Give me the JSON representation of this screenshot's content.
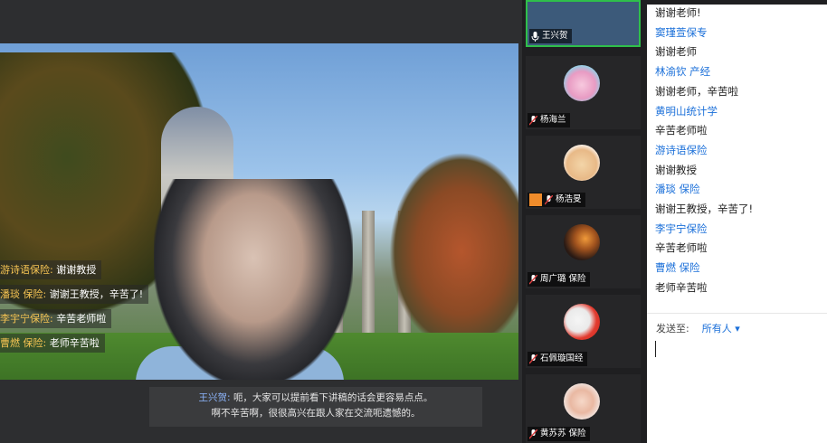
{
  "overlay_chat": [
    {
      "name": "游诗语保险:",
      "text": "谢谢教授"
    },
    {
      "name": "潘琰 保险:",
      "text": "谢谢王教授，辛苦了!"
    },
    {
      "name": "李宇宁保险:",
      "text": "辛苦老师啦"
    },
    {
      "name": "曹燃 保险:",
      "text": "老师辛苦啦"
    }
  ],
  "caption": {
    "speaker": "王兴贺:",
    "line1": "呃，大家可以提前看下讲稿的话会更容易点点。",
    "line2": "啊不辛苦啊，很很高兴在跟人家在交流呃遗憾的。"
  },
  "participants": [
    {
      "label": "王兴贺",
      "active": true
    },
    {
      "label": "杨海兰"
    },
    {
      "label": "杨浩旻"
    },
    {
      "label": "周广璐 保险"
    },
    {
      "label": "石佩璇国经"
    },
    {
      "label": "黄苏苏 保险"
    }
  ],
  "chat_panel": [
    {
      "type": "text",
      "value": "谢谢老师!"
    },
    {
      "type": "name",
      "value": "窦瑾萱保专"
    },
    {
      "type": "text",
      "value": "谢谢老师"
    },
    {
      "type": "name",
      "value": "林渝钦 产经"
    },
    {
      "type": "text",
      "value": "谢谢老师，辛苦啦"
    },
    {
      "type": "name",
      "value": "黄明山统计学"
    },
    {
      "type": "text",
      "value": "辛苦老师啦"
    },
    {
      "type": "name",
      "value": "游诗语保险"
    },
    {
      "type": "text",
      "value": "谢谢教授"
    },
    {
      "type": "name",
      "value": "潘琰 保险"
    },
    {
      "type": "text",
      "value": "谢谢王教授，辛苦了!"
    },
    {
      "type": "name",
      "value": "李宇宁保险"
    },
    {
      "type": "text",
      "value": "辛苦老师啦"
    },
    {
      "type": "name",
      "value": "曹燃 保险"
    },
    {
      "type": "text",
      "value": "老师辛苦啦"
    }
  ],
  "send": {
    "label": "发送至:",
    "target": "所有人 ▾"
  },
  "colors": {
    "accent": "#1a6fd9",
    "active_border": "#2fbf4b",
    "overlay_name": "#f6c453"
  }
}
